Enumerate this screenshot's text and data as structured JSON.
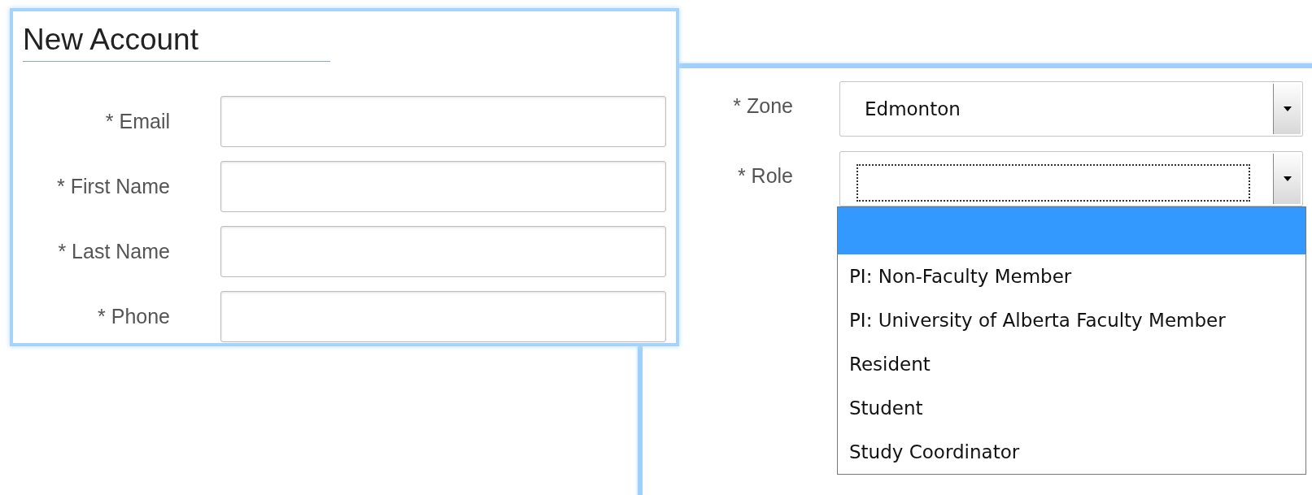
{
  "account_form": {
    "title": "New Account",
    "fields": [
      {
        "label": "* Email"
      },
      {
        "label": "* First Name"
      },
      {
        "label": "* Last Name"
      },
      {
        "label": "* Phone"
      }
    ]
  },
  "zone": {
    "label": "* Zone",
    "value": "Edmonton"
  },
  "role": {
    "label": "* Role",
    "focused": true,
    "expanded": true,
    "options": [
      {
        "selected": true
      },
      {
        "label": "PI: Non-Faculty Member",
        "selected": false
      },
      {
        "label": "PI: University of Alberta Faculty Member",
        "selected": false
      },
      {
        "label": "Resident",
        "selected": false
      },
      {
        "label": "Student",
        "selected": false
      },
      {
        "label": "Study Coordinator",
        "selected": false
      }
    ]
  }
}
